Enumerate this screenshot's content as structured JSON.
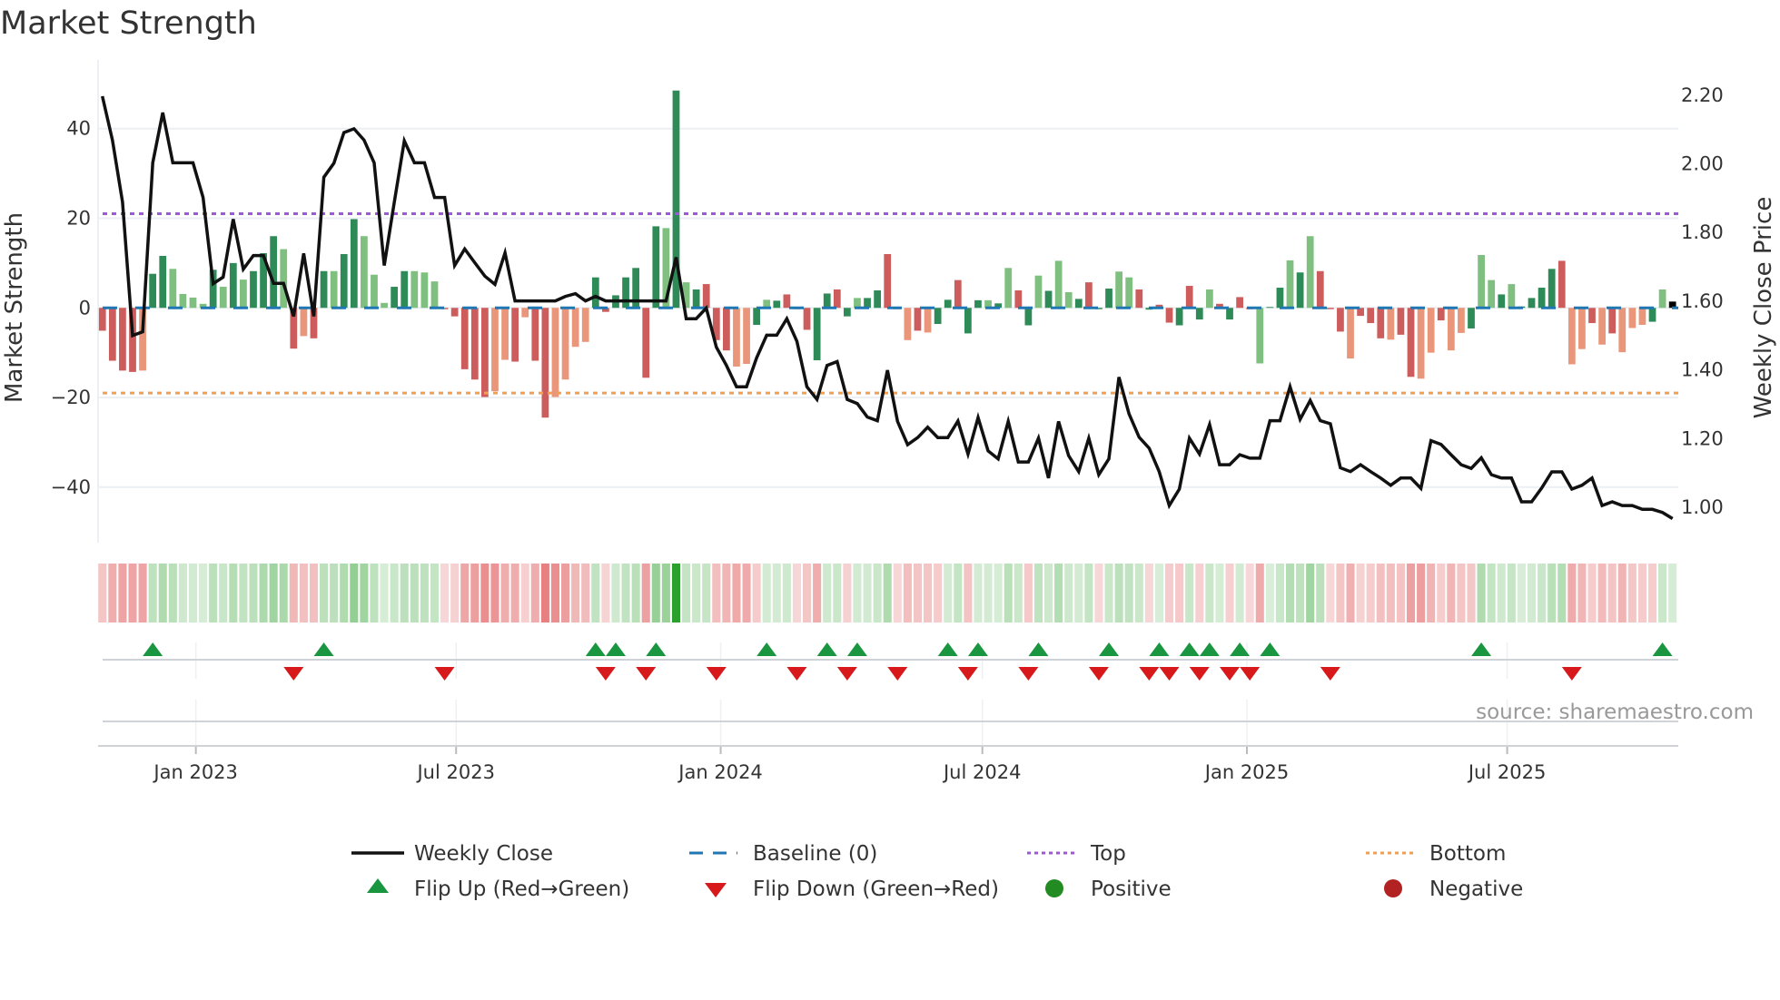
{
  "title": "Market Strength",
  "source": "source: sharemaestro.com",
  "colors": {
    "bar_up_strong": "#2e8b57",
    "bar_up_weak": "#7fbf7f",
    "bar_down_strong": "#cd5c5c",
    "bar_down_weak": "#e9967a",
    "heat_green": "#2ca02c",
    "heat_red": "#d62728",
    "close_line": "#111111",
    "baseline": "#1f77b4",
    "top": "#9b59d6",
    "bottom": "#f0a050",
    "flip_up": "#1a9641",
    "flip_down": "#d7191c",
    "positive": "#228b22",
    "negative": "#b22222",
    "grid": "#eceff3"
  },
  "chart_data": {
    "type": "bar+line",
    "title": "Market Strength",
    "x_start": "2022-10-28",
    "frequency": "weekly",
    "xlim": [
      "2022-10-25",
      "2025-10-28"
    ],
    "x_ticks": [
      {
        "date": "2023-01-01",
        "label": "Jan 2023"
      },
      {
        "date": "2023-07-01",
        "label": "Jul 2023"
      },
      {
        "date": "2024-01-01",
        "label": "Jan 2024"
      },
      {
        "date": "2024-07-01",
        "label": "Jul 2024"
      },
      {
        "date": "2025-01-01",
        "label": "Jan 2025"
      },
      {
        "date": "2025-07-01",
        "label": "Jul 2025"
      }
    ],
    "left_axis": {
      "label": "Market Strength",
      "ylim": [
        -52.4,
        52.3
      ],
      "ticks": [
        {
          "value": 40,
          "label": "40"
        },
        {
          "value": 20,
          "label": "20"
        },
        {
          "value": 0,
          "label": "0"
        },
        {
          "value": -20,
          "label": "−20"
        },
        {
          "value": -40,
          "label": "−40"
        }
      ]
    },
    "right_axis": {
      "label": "Weekly Close Price",
      "ylim": [
        0.897,
        2.263
      ],
      "ticks": [
        {
          "value": 2.2,
          "label": "2.20"
        },
        {
          "value": 2.0,
          "label": "2.00"
        },
        {
          "value": 1.8,
          "label": "1.80"
        },
        {
          "value": 1.6,
          "label": "1.60"
        },
        {
          "value": 1.4,
          "label": "1.40"
        },
        {
          "value": 1.2,
          "label": "1.20"
        },
        {
          "value": 1.0,
          "label": "1.00"
        }
      ]
    },
    "baseline": 0,
    "top_level": 21,
    "bottom_level": -19,
    "strength": [
      -5.1,
      -11.8,
      -14,
      -14.3,
      -14,
      7.6,
      11.6,
      8.7,
      3.1,
      2.3,
      0.9,
      8.5,
      4.7,
      10,
      6.3,
      8.2,
      12.2,
      16,
      13.1,
      -9.1,
      -6.3,
      -6.8,
      8.2,
      8.2,
      12,
      19.8,
      16,
      7.4,
      1.1,
      4.7,
      8.2,
      8.2,
      7.9,
      5.9,
      -0.3,
      -1.9,
      -13.7,
      -16,
      -19.9,
      -18.6,
      -11.6,
      -12,
      -2.1,
      -11.8,
      -24.5,
      -19.9,
      -16,
      -8.7,
      -7.6,
      6.8,
      -0.9,
      2.8,
      6.8,
      8.9,
      -15.6,
      18.2,
      17.8,
      48.5,
      5.7,
      4.1,
      5.3,
      -7.2,
      -9.5,
      -13.1,
      -12.5,
      -3.8,
      1.8,
      1.6,
      3,
      -0.3,
      -4.9,
      -11.7,
      3.2,
      4.1,
      -1.9,
      2.2,
      2.2,
      3.9,
      12,
      -0.3,
      -7.2,
      -5.1,
      -5.5,
      -3.6,
      1.8,
      6.2,
      -5.7,
      1.7,
      1.7,
      1.0,
      8.9,
      3.9,
      -3.9,
      7.2,
      3.8,
      10.5,
      3.5,
      2,
      5.7,
      -0.3,
      4.3,
      8.1,
      6.8,
      4.1,
      -0.4,
      0.7,
      -3.3,
      -3.9,
      4.9,
      -2.6,
      4.1,
      0.9,
      -2.6,
      2.4,
      -0.3,
      -12.4,
      0.2,
      4.5,
      10.6,
      7.9,
      16,
      8.2,
      -0.3,
      -5.3,
      -11.3,
      -1.8,
      -3.4,
      -6.8,
      -7.1,
      -6,
      -15.4,
      -15.8,
      -10,
      -2.8,
      -9.5,
      -5.6,
      -4.6,
      11.8,
      6.2,
      3,
      5.3,
      0.3,
      2.2,
      4.5,
      8.7,
      10.5,
      -12.6,
      -9.2,
      -3.4,
      -8.2,
      -5.7,
      -9.9,
      -4.5,
      -3.8,
      -3.1,
      4.1,
      1.4
    ],
    "strength_shade": "RRRRrGGggggGgGgGGGgRrRGgGGgggGGgggRRRRRrrRrRRrrrrGRGGGRGgGgGRRRrrGgGRRRGGRGgGGRRrRrGGRGGgGgRGgGggGRGGggRGRRGRGgRGRRgGGgGgRRRrRRRrRRrrRrrGggGgGGGGRrrRrRrrrGg",
    "weekly_close": [
      2.197,
      2.069,
      1.889,
      1.5,
      1.511,
      2.003,
      2.149,
      2.003,
      2.003,
      2.003,
      1.902,
      1.651,
      1.67,
      1.839,
      1.693,
      1.733,
      1.733,
      1.652,
      1.652,
      1.556,
      1.739,
      1.556,
      1.961,
      2.002,
      2.091,
      2.102,
      2.069,
      2.003,
      1.704,
      1.889,
      2.067,
      2.003,
      2.003,
      1.902,
      1.902,
      1.704,
      1.752,
      1.712,
      1.673,
      1.649,
      1.741,
      1.601,
      1.601,
      1.601,
      1.601,
      1.601,
      1.614,
      1.622,
      1.601,
      1.614,
      1.601,
      1.601,
      1.601,
      1.601,
      1.601,
      1.601,
      1.601,
      1.728,
      1.549,
      1.549,
      1.58,
      1.466,
      1.413,
      1.351,
      1.351,
      1.435,
      1.501,
      1.501,
      1.549,
      1.483,
      1.351,
      1.314,
      1.413,
      1.424,
      1.314,
      1.302,
      1.263,
      1.252,
      1.399,
      1.25,
      1.182,
      1.203,
      1.233,
      1.203,
      1.203,
      1.251,
      1.155,
      1.261,
      1.164,
      1.141,
      1.25,
      1.132,
      1.132,
      1.201,
      1.085,
      1.25,
      1.15,
      1.104,
      1.201,
      1.095,
      1.141,
      1.379,
      1.272,
      1.204,
      1.172,
      1.104,
      1.005,
      1.053,
      1.201,
      1.155,
      1.241,
      1.124,
      1.124,
      1.153,
      1.143,
      1.143,
      1.252,
      1.252,
      1.351,
      1.256,
      1.311,
      1.252,
      1.243,
      1.115,
      1.104,
      1.124,
      1.104,
      1.085,
      1.064,
      1.085,
      1.085,
      1.055,
      1.194,
      1.183,
      1.153,
      1.124,
      1.113,
      1.144,
      1.095,
      1.085,
      1.085,
      1.016,
      1.016,
      1.056,
      1.103,
      1.103,
      1.053,
      1.064,
      1.085,
      1.005,
      1.016,
      1.005,
      1.005,
      0.994,
      0.994,
      0.985,
      0.967
    ],
    "flip_up_weeks": [
      6,
      23,
      50,
      52,
      56,
      67,
      73,
      76,
      85,
      88,
      94,
      101,
      106,
      109,
      111,
      114,
      117,
      138,
      156
    ],
    "flip_down_weeks": [
      20,
      35,
      51,
      55,
      62,
      70,
      75,
      80,
      87,
      93,
      100,
      105,
      107,
      110,
      113,
      115,
      123,
      147
    ],
    "legend": {
      "weekly_close": "Weekly Close",
      "baseline": "Baseline (0)",
      "top": "Top",
      "bottom": "Bottom",
      "flip_up": "Flip Up (Red→Green)",
      "flip_down": "Flip Down (Green→Red)",
      "positive": "Positive",
      "negative": "Negative"
    }
  }
}
